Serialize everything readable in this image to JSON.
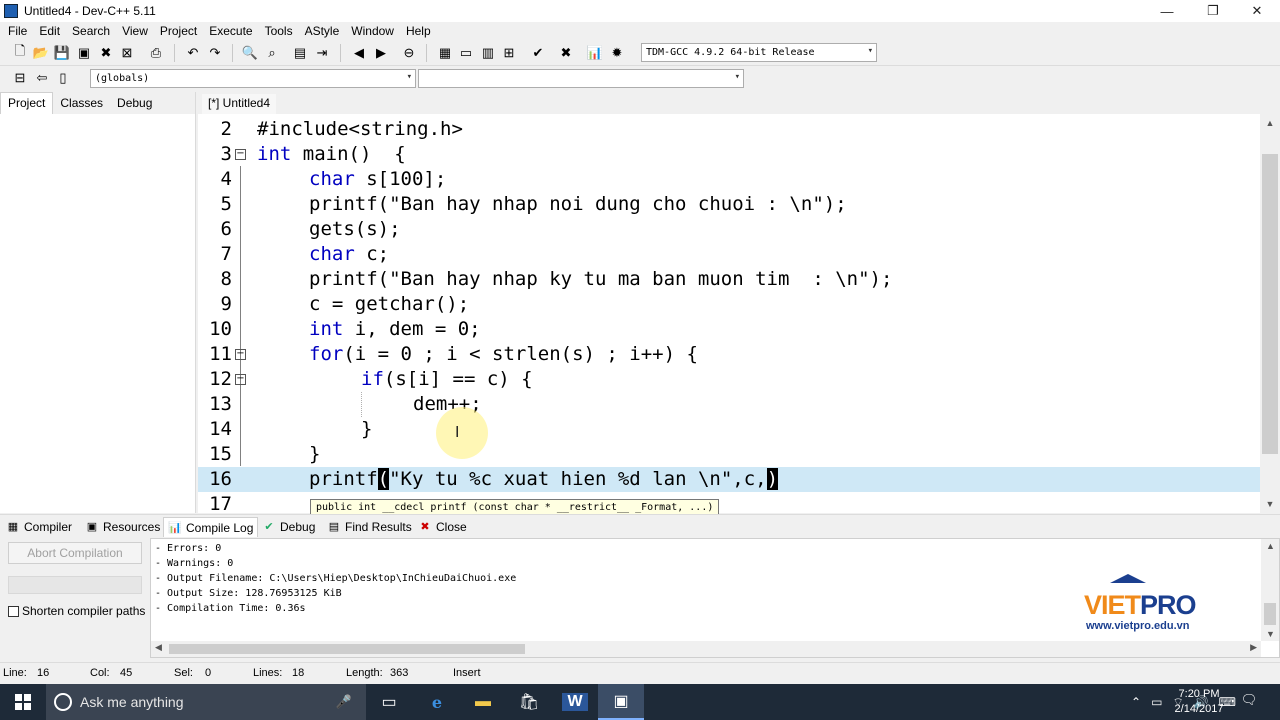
{
  "window": {
    "title": "Untitled4 - Dev-C++ 5.11",
    "controls": [
      "—",
      "❐",
      "✕"
    ]
  },
  "menu": [
    "File",
    "Edit",
    "Search",
    "View",
    "Project",
    "Execute",
    "Tools",
    "AStyle",
    "Window",
    "Help"
  ],
  "toolbar": {
    "compiler": "TDM-GCC 4.9.2 64-bit Release",
    "scope": "(globals)"
  },
  "left_panel": {
    "tabs": [
      "Project",
      "Classes",
      "Debug"
    ]
  },
  "editor": {
    "tab_label": "[*] Untitled4",
    "lines": [
      {
        "n": "2",
        "code": "#include<string.h>"
      },
      {
        "n": "3",
        "kw": "int",
        "code": " main()  {"
      },
      {
        "n": "4",
        "kw": "char",
        "code": " s[100];"
      },
      {
        "n": "5",
        "code": "printf(\"Ban hay nhap noi dung cho chuoi : \\n\");"
      },
      {
        "n": "6",
        "code": "gets(s);"
      },
      {
        "n": "7",
        "kw": "char",
        "code": " c;"
      },
      {
        "n": "8",
        "code": "printf(\"Ban hay nhap ky tu ma ban muon tim  : \\n\");"
      },
      {
        "n": "9",
        "code": "c = getchar();"
      },
      {
        "n": "10",
        "kw": "int",
        "code": " i, dem = 0;"
      },
      {
        "n": "11",
        "kw": "for",
        "code": "(i = 0 ; i < strlen(s) ; i++) {"
      },
      {
        "n": "12",
        "kw": "if",
        "code": "(s[i] == c) {"
      },
      {
        "n": "13",
        "code": "dem++;"
      },
      {
        "n": "14",
        "code": "}"
      },
      {
        "n": "15",
        "code": "}"
      },
      {
        "n": "16",
        "pre": "printf",
        "cur1": "(",
        "mid": "\"Ky tu %c xuat hien %d lan \\n\",c,",
        "cur2": ")"
      },
      {
        "n": "17",
        "code": ""
      }
    ],
    "hint": "public int __cdecl printf (const char * __restrict__ _Format, ...)"
  },
  "bottom_tabs": [
    "Compiler",
    "Resources",
    "Compile Log",
    "Debug",
    "Find Results",
    "Close"
  ],
  "compile": {
    "abort_label": "Abort Compilation",
    "shorten_label": "Shorten compiler paths",
    "log": [
      "- Errors: 0",
      "- Warnings: 0",
      "- Output Filename: C:\\Users\\Hiep\\Desktop\\InChieuDaiChuoi.exe",
      "- Output Size: 128.76953125 KiB",
      "- Compilation Time: 0.36s"
    ]
  },
  "logo": {
    "brand_1": "VIET",
    "brand_2": "PRO",
    "url": "www.vietpro.edu.vn"
  },
  "status": {
    "line_label": "Line:",
    "line": "16",
    "col_label": "Col:",
    "col": "45",
    "sel_label": "Sel:",
    "sel": "0",
    "lines_label": "Lines:",
    "lines": "18",
    "length_label": "Length:",
    "length": "363",
    "mode": "Insert"
  },
  "taskbar": {
    "search_placeholder": "Ask me anything",
    "time": "7:20 PM",
    "date": "2/14/2017"
  },
  "colors": {
    "keyword": "#0000c0",
    "current_line": "#cfe8f6",
    "taskbar": "#1e2a38",
    "brand_orange": "#f08a1a",
    "brand_blue": "#1b3f8f"
  }
}
